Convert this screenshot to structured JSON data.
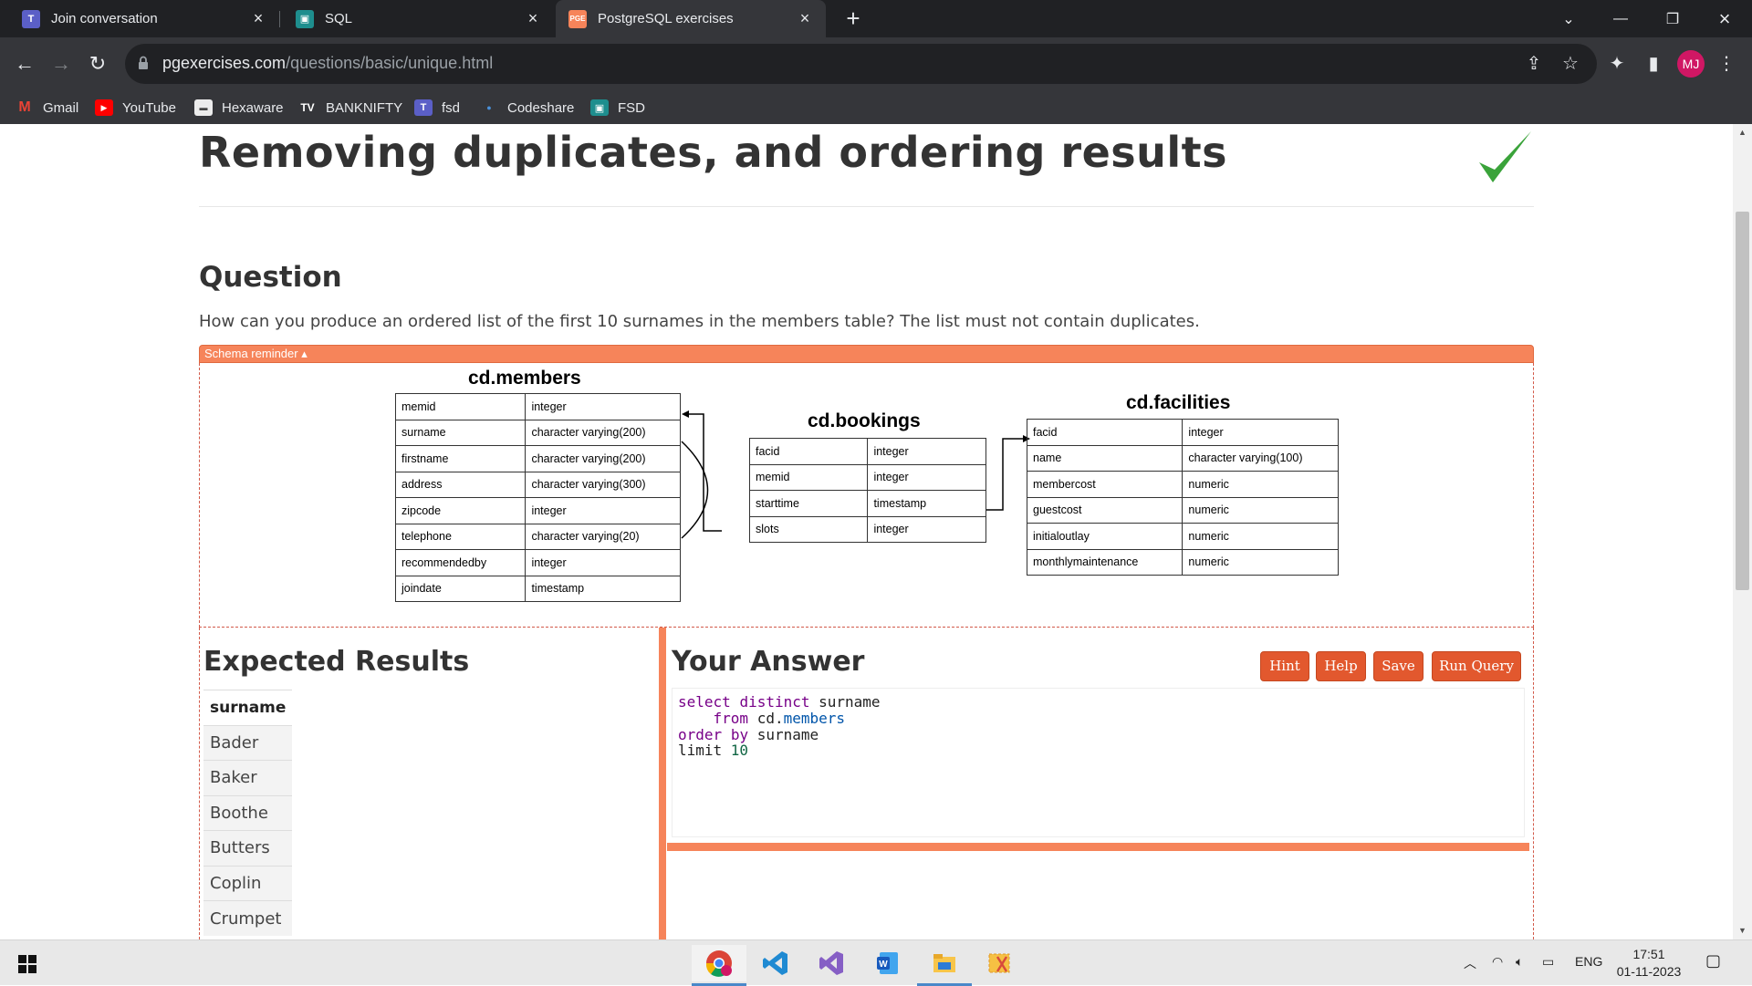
{
  "browser": {
    "tabs": [
      {
        "label": "Join conversation",
        "icon": "teams-icon"
      },
      {
        "label": "SQL",
        "icon": "classroom-icon"
      },
      {
        "label": "PostgreSQL exercises",
        "icon": "pge-icon",
        "active": true
      }
    ],
    "url_host": "pgexercises.com",
    "url_path": "/questions/basic/unique.html",
    "profile_initials": "MJ",
    "bookmarks": [
      {
        "label": "Gmail",
        "icon": "gmail-icon"
      },
      {
        "label": "YouTube",
        "icon": "youtube-icon"
      },
      {
        "label": "Hexaware",
        "icon": "hexaware-icon"
      },
      {
        "label": "BANKNIFTY",
        "icon": "tradingview-icon"
      },
      {
        "label": "fsd",
        "icon": "teams-icon"
      },
      {
        "label": "Codeshare",
        "icon": "dot-icon"
      },
      {
        "label": "FSD",
        "icon": "classroom-icon"
      }
    ]
  },
  "page": {
    "title": "Removing duplicates, and ordering results",
    "question_heading": "Question",
    "question_text": "How can you produce an ordered list of the first 10 surnames in the members table? The list must not contain duplicates.",
    "schema_toggle": "Schema reminder ▴",
    "schema": {
      "members": {
        "name": "cd.members",
        "columns": [
          [
            "memid",
            "integer"
          ],
          [
            "surname",
            "character varying(200)"
          ],
          [
            "firstname",
            "character varying(200)"
          ],
          [
            "address",
            "character varying(300)"
          ],
          [
            "zipcode",
            "integer"
          ],
          [
            "telephone",
            "character varying(20)"
          ],
          [
            "recommendedby",
            "integer"
          ],
          [
            "joindate",
            "timestamp"
          ]
        ]
      },
      "bookings": {
        "name": "cd.bookings",
        "columns": [
          [
            "facid",
            "integer"
          ],
          [
            "memid",
            "integer"
          ],
          [
            "starttime",
            "timestamp"
          ],
          [
            "slots",
            "integer"
          ]
        ]
      },
      "facilities": {
        "name": "cd.facilities",
        "columns": [
          [
            "facid",
            "integer"
          ],
          [
            "name",
            "character varying(100)"
          ],
          [
            "membercost",
            "numeric"
          ],
          [
            "guestcost",
            "numeric"
          ],
          [
            "initialoutlay",
            "numeric"
          ],
          [
            "monthlymaintenance",
            "numeric"
          ]
        ]
      }
    },
    "expected": {
      "heading": "Expected Results",
      "column": "surname",
      "rows": [
        "Bader",
        "Baker",
        "Boothe",
        "Butters",
        "Coplin",
        "Crumpet"
      ]
    },
    "answer": {
      "heading": "Your Answer",
      "buttons": {
        "hint": "Hint",
        "help": "Help",
        "save": "Save",
        "run": "Run Query"
      },
      "code": [
        {
          "parts": [
            [
              "kw",
              "select"
            ],
            [
              "",
              " "
            ],
            [
              "kw",
              "distinct"
            ],
            [
              "",
              " surname"
            ]
          ]
        },
        {
          "parts": [
            [
              "",
              "    "
            ],
            [
              "kw",
              "from"
            ],
            [
              "",
              " cd."
            ],
            [
              "tbl",
              "members"
            ]
          ]
        },
        {
          "parts": [
            [
              "kw",
              "order"
            ],
            [
              "",
              " "
            ],
            [
              "kw",
              "by"
            ],
            [
              "",
              " surname"
            ]
          ]
        },
        {
          "parts": [
            [
              "",
              "limit "
            ],
            [
              "num",
              "10"
            ]
          ]
        }
      ]
    }
  },
  "taskbar": {
    "apps": [
      "chrome-icon",
      "vscode-icon",
      "visual-studio-icon",
      "word-icon",
      "file-explorer-icon",
      "snipping-tool-icon"
    ],
    "language": "ENG",
    "time": "17:51",
    "date": "01-11-2023"
  }
}
